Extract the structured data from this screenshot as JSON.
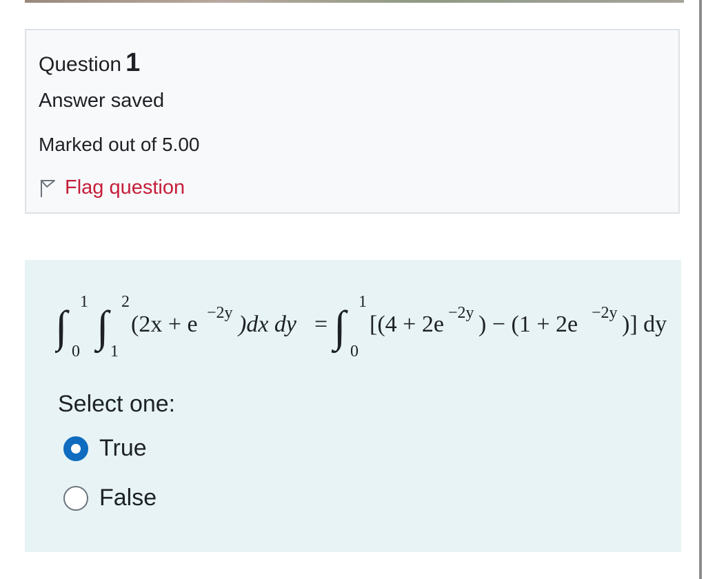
{
  "question": {
    "label": "Question",
    "number": "1",
    "state": "Answer saved",
    "grade": "Marked out of 5.00",
    "flag_label": "Flag question",
    "flag_icon": "flag-outline-icon"
  },
  "content": {
    "formula": {
      "lhs_outer": {
        "lower": "0",
        "upper": "1"
      },
      "lhs_inner": {
        "lower": "1",
        "upper": "2"
      },
      "lhs_integrand": "(2x + e",
      "lhs_exp": "−2y",
      "lhs_tail": ")dx dy",
      "equals": "=",
      "rhs": {
        "lower": "0",
        "upper": "1"
      },
      "rhs_a": "[(4 + 2e",
      "rhs_exp1": "−2y",
      "rhs_b": ") − (1 + 2e",
      "rhs_exp2": "−2y",
      "rhs_c": ")] dy"
    },
    "prompt": "Select one:",
    "options": [
      {
        "label": "True",
        "checked": true
      },
      {
        "label": "False",
        "checked": false
      }
    ]
  },
  "colors": {
    "flag": "#c51d3a",
    "radio_checked": "#0f6cbf",
    "content_bg": "#e7f3f5",
    "info_bg": "#f8f9fa"
  }
}
